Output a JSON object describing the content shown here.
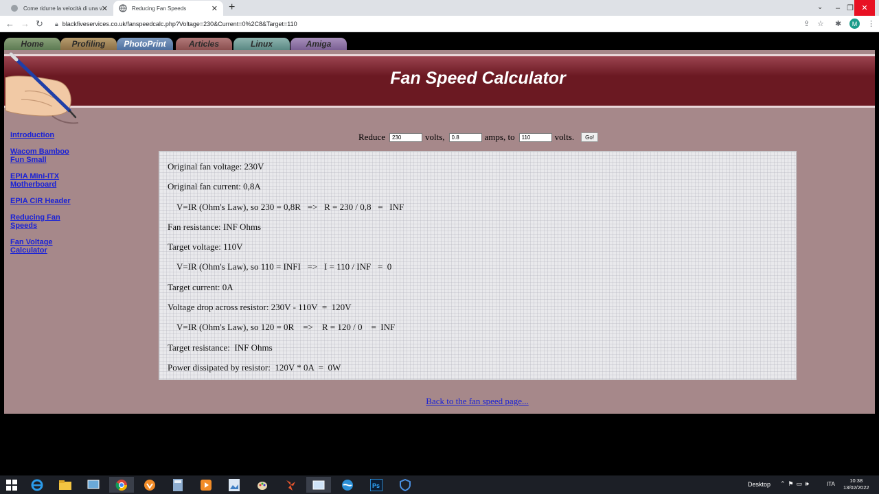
{
  "browser": {
    "tabs": [
      {
        "label": "Come ridurre la velocità di una v"
      },
      {
        "label": "Reducing Fan Speeds"
      }
    ],
    "new_tab": "+",
    "url": "blackfiveservices.co.uk/fanspeedcalc.php?Voltage=230&Current=0%2C8&Target=110",
    "profile_initial": "M"
  },
  "site_nav": [
    "Home",
    "Profiling",
    "PhotoPrint",
    "Articles",
    "Linux",
    "Amiga"
  ],
  "page_title": "Fan Speed Calculator",
  "sidebar": [
    {
      "label_1": "Introduction",
      "label_2": ""
    },
    {
      "label_1": "Wacom Bamboo",
      "label_2": "Fun Small"
    },
    {
      "label_1": "EPIA Mini-ITX",
      "label_2": "Motherboard"
    },
    {
      "label_1": "EPIA CIR Header",
      "label_2": ""
    },
    {
      "label_1": "Reducing Fan",
      "label_2": "Speeds"
    },
    {
      "label_1": "Fan Voltage",
      "label_2": "Calculator"
    }
  ],
  "form": {
    "reduce_label": "Reduce",
    "voltage_value": "230",
    "volts_label": "volts,",
    "current_value": "0.8",
    "amps_label": "amps, to",
    "target_value": "110",
    "target_volts_label": "volts.",
    "go_label": "Go!"
  },
  "results": [
    "Original fan voltage: 230V",
    "Original fan current: 0,8A",
    "V=IR (Ohm's Law), so 230 = 0,8R   =>   R = 230 / 0,8   =   INF",
    "Fan resistance: INF Ohms",
    "Target voltage: 110V",
    "V=IR (Ohm's Law), so 110 = INFI   =>   I = 110 / INF   =  0",
    "Target current: 0A",
    "Voltage drop across resistor: 230V - 110V  =  120V",
    "V=IR (Ohm's Law), so 120 = 0R    =>    R = 120 / 0    =  INF",
    "Target resistance:  INF Ohms",
    "Power dissipated by resistor:  120V * 0A  =  0W"
  ],
  "back_link": "Back to the fan speed page...",
  "taskbar": {
    "desktop_label": "Desktop",
    "language": "ITA",
    "time": "10:38",
    "date": "13/02/2022"
  }
}
